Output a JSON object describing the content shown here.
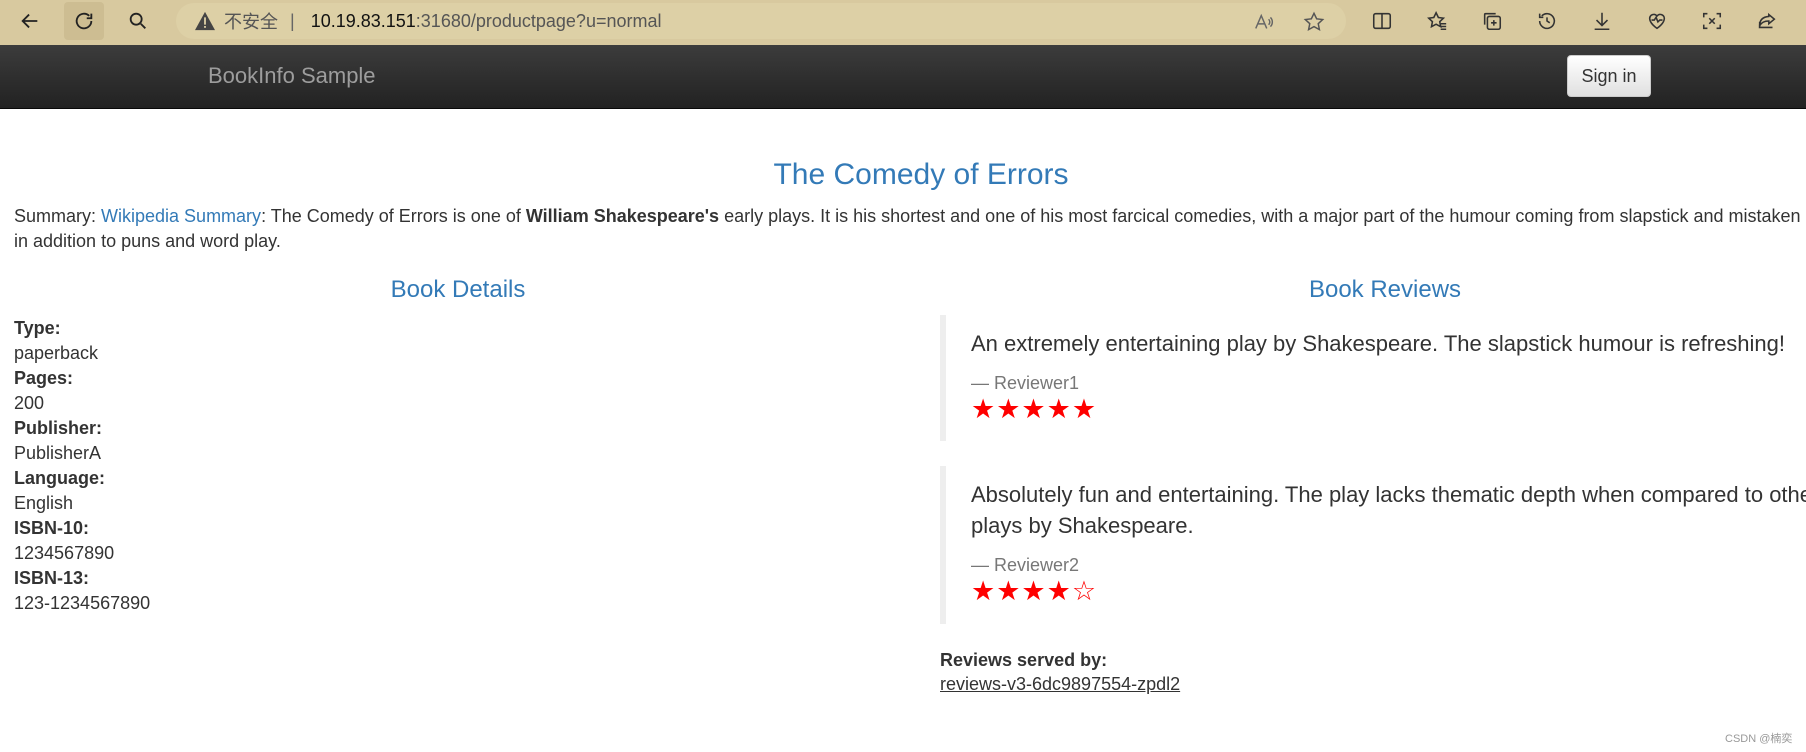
{
  "browser": {
    "security_label": "不安全",
    "separator": "|",
    "url_host": "10.19.83.151",
    "url_rest": ":31680/productpage?u=normal"
  },
  "app": {
    "brand": "BookInfo Sample",
    "signin_label": "Sign in"
  },
  "book": {
    "title": "The Comedy of Errors",
    "summary_label": "Summary: ",
    "summary_link": "Wikipedia Summary",
    "summary_text_1": ": The Comedy of Errors is one of ",
    "summary_bold": "William Shakespeare's",
    "summary_text_2": " early plays. It is his shortest and one of his most farcical comedies, with a major part of the humour coming from slapstick and mistaken identity,",
    "summary_text_3": "in addition to puns and word play."
  },
  "details": {
    "heading": "Book Details",
    "fields": [
      {
        "label": "Type:",
        "value": "paperback"
      },
      {
        "label": "Pages:",
        "value": "200"
      },
      {
        "label": "Publisher:",
        "value": "PublisherA"
      },
      {
        "label": "Language:",
        "value": "English"
      },
      {
        "label": "ISBN-10:",
        "value": "1234567890"
      },
      {
        "label": "ISBN-13:",
        "value": "123-1234567890"
      }
    ]
  },
  "reviews": {
    "heading": "Book Reviews",
    "items": [
      {
        "text": "An extremely entertaining play by Shakespeare. The slapstick humour is refreshing!",
        "author": "— Reviewer1",
        "rating": 5,
        "stars": "★★★★★"
      },
      {
        "text": "Absolutely fun and entertaining. The play lacks thematic depth when compared to other plays by Shakespeare.",
        "author": "— Reviewer2",
        "rating": 4,
        "stars": "★★★★☆"
      }
    ],
    "served_by_label": "Reviews served by:",
    "served_by_value": "reviews-v3-6dc9897554-zpdl2"
  },
  "watermark": "CSDN @楠奕",
  "colors": {
    "link": "#337ab7",
    "star": "#ff0000",
    "navbar": "#222222",
    "browser_bar": "#d8c99f"
  },
  "icons": [
    "back-icon",
    "refresh-icon",
    "search-icon",
    "warning-icon",
    "read-aloud-icon",
    "favorite-star-icon",
    "split-screen-icon",
    "favorites-icon",
    "collections-icon",
    "history-icon",
    "download-icon",
    "health-icon",
    "screenshot-icon",
    "share-icon"
  ]
}
